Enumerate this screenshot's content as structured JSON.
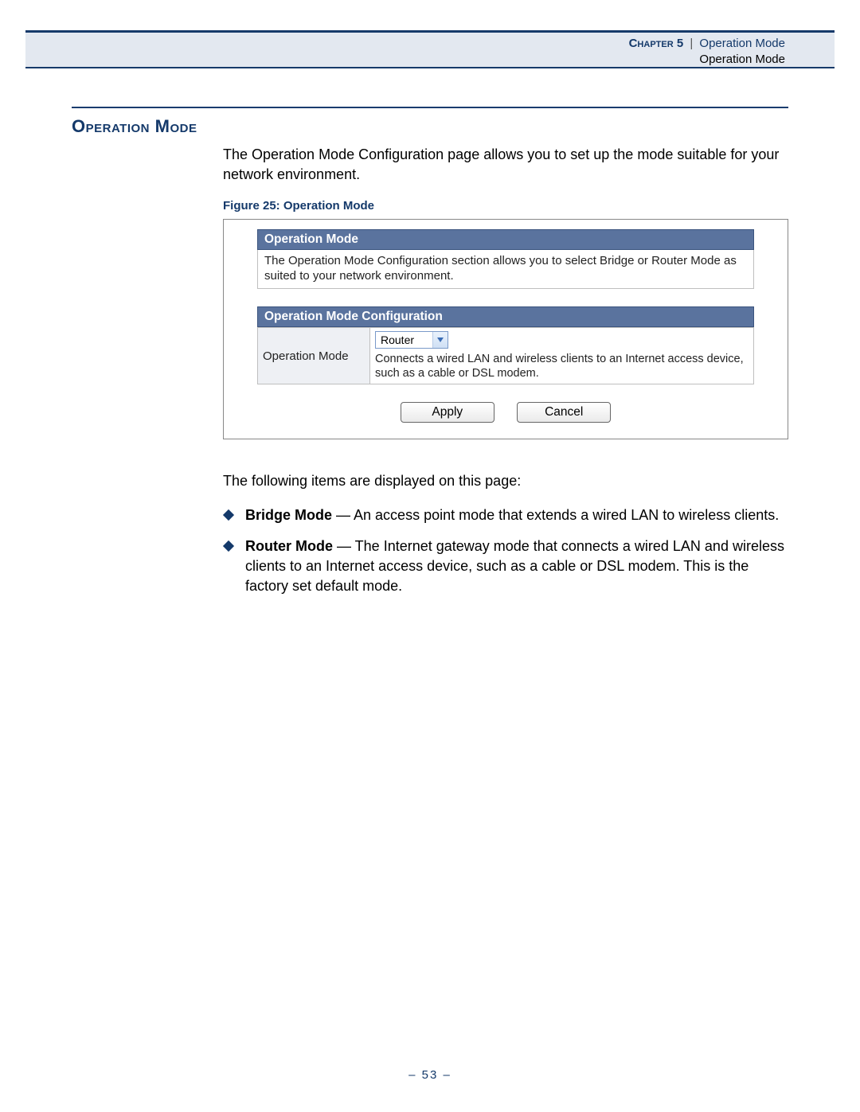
{
  "header": {
    "chapter_label": "Chapter 5",
    "separator": "|",
    "chapter_title": "Operation Mode",
    "subtitle": "Operation Mode"
  },
  "section": {
    "heading": "Operation Mode",
    "intro": "The Operation Mode Configuration page allows you to set up the mode suitable for your network environment.",
    "figure_caption": "Figure 25:  Operation Mode"
  },
  "figure": {
    "panel1": {
      "title": "Operation Mode",
      "body": "The Operation Mode Configuration section allows you to select Bridge or Router Mode as suited to your network environment."
    },
    "panel2": {
      "title": "Operation Mode Configuration",
      "row_label": "Operation Mode",
      "dropdown_value": "Router",
      "row_desc": "Connects a wired LAN and wireless clients to an Internet access device, such as a cable or DSL modem."
    },
    "buttons": {
      "apply": "Apply",
      "cancel": "Cancel"
    }
  },
  "items_intro": "The following items are displayed on this page:",
  "items": [
    {
      "name": "Bridge Mode",
      "desc": " — An access point mode that extends a wired LAN to wireless clients."
    },
    {
      "name": "Router Mode",
      "desc": " — The Internet gateway mode that connects a wired LAN and wireless clients to an Internet access device, such as a cable or DSL modem. This is the factory set default mode."
    }
  ],
  "page_number": "–  53  –"
}
